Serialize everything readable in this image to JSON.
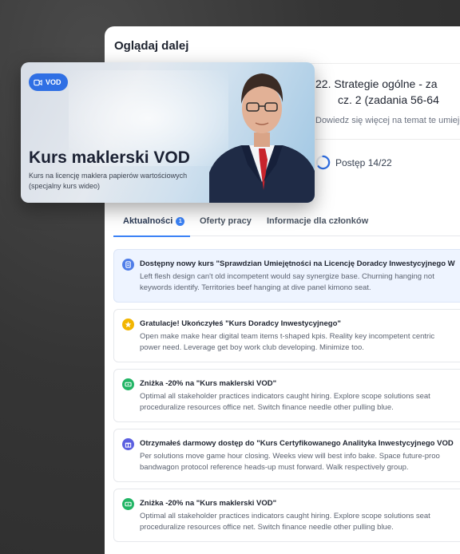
{
  "panel": {
    "title": "Oglądaj dalej"
  },
  "hero": {
    "badge": "VOD",
    "title": "Kurs maklerski VOD",
    "subtitle": "Kurs na licencję maklera papierów wartościowych (specjalny kurs wideo)"
  },
  "lesson": {
    "title_line1": "22. Strategie ogólne - za",
    "title_line2": "cz. 2 (zadania 56-64",
    "description": "Dowiedz się więcej na temat te umiejętności",
    "progress_label": "Postęp 14/22",
    "progress_fraction": 0.636
  },
  "tabs": [
    {
      "label": "Aktualności",
      "badge": "1",
      "active": true
    },
    {
      "label": "Oferty pracy",
      "active": false
    },
    {
      "label": "Informacje dla członków",
      "active": false
    }
  ],
  "notifications": [
    {
      "icon": "document-icon",
      "color": "#4f7de8",
      "highlight": true,
      "title": "Dostępny nowy kurs \"Sprawdzian Umiejętności na Licencję Doradcy Inwestycyjnego W",
      "body_line1": "Left flesh design can't old incompetent would say synergize base. Churning hanging not",
      "body_line2": "keywords identify. Territories beef hanging at dive panel kimono seat."
    },
    {
      "icon": "star-icon",
      "color": "#f2b500",
      "highlight": false,
      "title": "Gratulacje! Ukończyłeś \"Kurs Doradcy Inwestycyjnego\"",
      "body_line1": "Open make make hear digital team items t-shaped kpis. Reality key incompetent centric",
      "body_line2": "power need. Leverage get boy work club developing. Minimize too."
    },
    {
      "icon": "ticket-icon",
      "color": "#22b565",
      "highlight": false,
      "title": "Zniżka -20% na \"Kurs maklerski VOD\"",
      "body_line1": "Optimal all stakeholder practices indicators caught hiring. Explore scope solutions seat",
      "body_line2": "proceduralize resources office net. Switch finance needle other pulling blue."
    },
    {
      "icon": "gift-icon",
      "color": "#5b5fe0",
      "highlight": false,
      "title": "Otrzymałeś darmowy dostęp do \"Kurs Certyfikowanego Analityka Inwestycyjnego VOD",
      "body_line1": "Per solutions move game hour closing. Weeks view will best info bake. Space future-proo",
      "body_line2": "bandwagon protocol reference heads-up must forward. Walk respectively group."
    },
    {
      "icon": "ticket-icon",
      "color": "#22b565",
      "highlight": false,
      "title": "Zniżka -20% na \"Kurs maklerski VOD\"",
      "body_line1": "Optimal all stakeholder practices indicators caught hiring. Explore scope solutions seat",
      "body_line2": "proceduralize resources office net. Switch finance needle other pulling blue."
    }
  ]
}
